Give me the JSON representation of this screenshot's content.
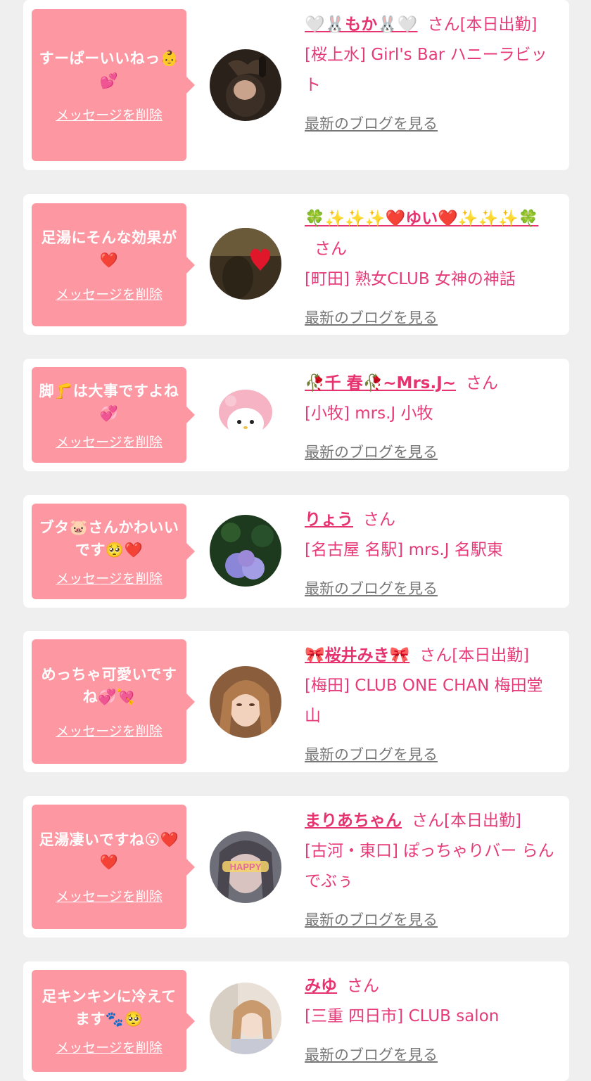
{
  "delete_label": "メッセージを削除",
  "blog_label": "最新のブログを見る",
  "san_label": "さん",
  "items": [
    {
      "message": "すーぱーいいねっ👶💕",
      "name": "🤍🐰もか🐰🤍",
      "status": "[本日出勤]",
      "shop": "[桜上水] Girl's Bar ハニーラビット"
    },
    {
      "message": "足湯にそんな効果が❤️",
      "name": "🍀✨✨✨❤️ゆい❤️✨✨✨🍀",
      "status": "",
      "shop": "[町田] 熟女CLUB 女神の神話"
    },
    {
      "message": "脚🦵は大事ですよね💞",
      "name": "🥀千 春🥀~Mrs.J~",
      "status": "",
      "shop": "[小牧] mrs.J 小牧"
    },
    {
      "message": "ブタ🐷さんかわいいです🥺❤️",
      "name": "りょう",
      "status": "",
      "shop": "[名古屋 名駅] mrs.J 名駅東"
    },
    {
      "message": "めっちゃ可愛いですね💞💘",
      "name": "🎀桜井みき🎀",
      "status": "[本日出勤]",
      "shop": "[梅田] CLUB ONE CHAN 梅田堂山"
    },
    {
      "message": "足湯凄いですね😮❤️❤️",
      "name": "まりあちゃん",
      "status": "[本日出勤]",
      "shop": "[古河・東口] ぽっちゃりバー らんでぶぅ"
    },
    {
      "message": "足キンキンに冷えてます🐾🥺",
      "name": "みゆ",
      "status": "",
      "shop": "[三重 四日市] CLUB salon"
    }
  ]
}
